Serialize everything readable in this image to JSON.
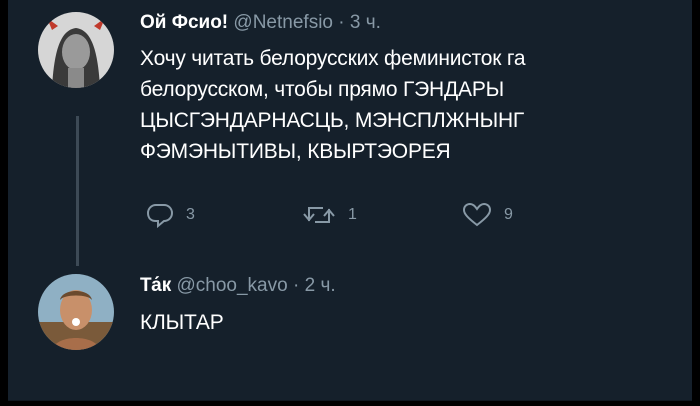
{
  "tweets": [
    {
      "name": "Ой Фсио!",
      "handle": "@Netnefsio",
      "sep": "·",
      "time": "3 ч.",
      "text": "Хочу читать белорусских феминисток га\nбелорусском, чтобы прямо ГЭНДАРЫ\nЦЫСГЭНДАРНАСЦЬ, МЭНСПЛЖНЫНГ\nФЭМЭНЫТИВЫ, КВЫРТЭОРЕЯ",
      "actions": {
        "reply_count": "3",
        "retweet_count": "1",
        "like_count": "9"
      },
      "avatar_icon": "devil-horns-avatar"
    },
    {
      "name": "Та́к",
      "handle": "@choo_kavo",
      "sep": "·",
      "time": "2 ч.",
      "text": "КЛЫТАР",
      "avatar_icon": "man-portrait-avatar"
    }
  ],
  "colors": {
    "background": "#15202b",
    "text_primary": "#ffffff",
    "text_secondary": "#8899a6",
    "thread_line": "#3d4a56"
  }
}
